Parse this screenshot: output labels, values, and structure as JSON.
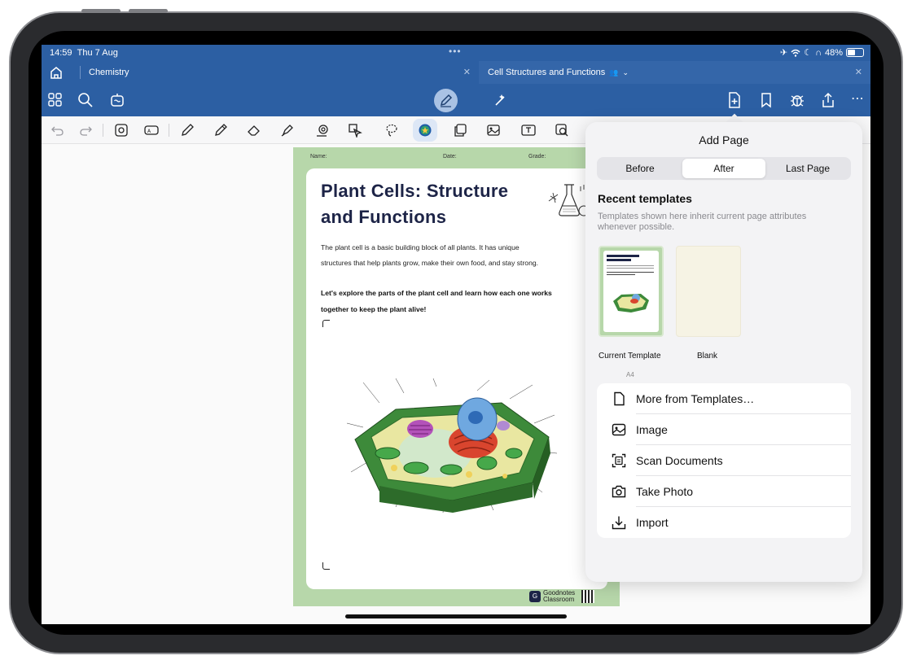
{
  "status_bar": {
    "time": "14:59",
    "date": "Thu 7 Aug",
    "battery_percent": "48%",
    "battery_level": 0.48
  },
  "tabs": [
    {
      "label": "Chemistry"
    },
    {
      "label": "Cell Structures and Functions"
    }
  ],
  "document": {
    "header": {
      "name_label": "Name:",
      "date_label": "Date:",
      "grade_label": "Grade:"
    },
    "title_line1": "Plant Cells: Structure",
    "title_line2": "and Functions",
    "paragraph_line1": "The plant cell is a basic building block of all plants. It has unique",
    "paragraph_line2": "structures that help plants grow, make their own food, and stay strong.",
    "bold_line1": "Let's explore the parts of the plant cell and learn how each one works",
    "bold_line2": "together to keep the plant alive!",
    "logo_text": "Goodnotes Classroom"
  },
  "add_page_panel": {
    "title": "Add Page",
    "segments": [
      "Before",
      "After",
      "Last Page"
    ],
    "selected_segment": "After",
    "recent_title": "Recent templates",
    "recent_subtitle": "Templates shown here inherit current page attributes whenever possible.",
    "templates": [
      {
        "label": "Current Template",
        "sub": "A4"
      },
      {
        "label": "Blank",
        "sub": ""
      }
    ],
    "menu_items": [
      {
        "label": "More from Templates…",
        "icon": "document-icon"
      },
      {
        "label": "Image",
        "icon": "image-icon"
      },
      {
        "label": "Scan Documents",
        "icon": "scan-icon"
      },
      {
        "label": "Take Photo",
        "icon": "camera-icon"
      },
      {
        "label": "Import",
        "icon": "import-icon"
      }
    ]
  },
  "colors": {
    "header_blue": "#2c5fa3",
    "page_green": "#b7d7aa",
    "title_navy": "#1d2447"
  }
}
